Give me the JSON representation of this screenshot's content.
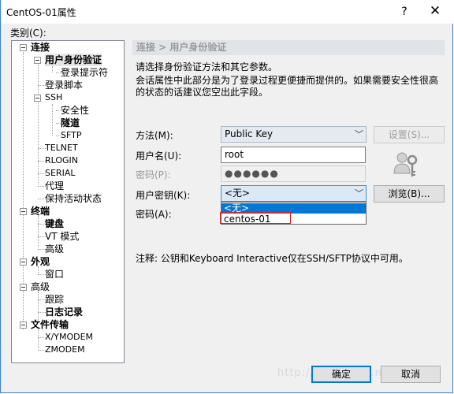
{
  "window": {
    "title": "CentOS-01属性",
    "help": "?",
    "close": "✕"
  },
  "category_label": "类别(C):",
  "tree": [
    {
      "id": "lianjie",
      "label": "连接",
      "bold": true
    },
    {
      "id": "yonghu",
      "label": "用户身份验证",
      "bold": true,
      "selected": true
    },
    {
      "id": "denglu-tishi",
      "label": "登录提示符"
    },
    {
      "id": "denglu-jiaoben",
      "label": "登录脚本"
    },
    {
      "id": "ssh",
      "label": "SSH",
      "small": true
    },
    {
      "id": "anquan",
      "label": "安全性"
    },
    {
      "id": "suidao",
      "label": "隧道",
      "bold": true
    },
    {
      "id": "sftp",
      "label": "SFTP",
      "small": true
    },
    {
      "id": "telnet",
      "label": "TELNET",
      "small": true
    },
    {
      "id": "rlogin",
      "label": "RLOGIN",
      "small": true
    },
    {
      "id": "serial",
      "label": "SERIAL",
      "small": true
    },
    {
      "id": "daili",
      "label": "代理"
    },
    {
      "id": "baochi",
      "label": "保持活动状态"
    },
    {
      "id": "zhongduan",
      "label": "终端",
      "bold": true
    },
    {
      "id": "jianpan",
      "label": "键盘",
      "bold": true
    },
    {
      "id": "vt",
      "label": "VT 模式"
    },
    {
      "id": "gaoji1",
      "label": "高级"
    },
    {
      "id": "waiguan",
      "label": "外观",
      "bold": true
    },
    {
      "id": "chuangkou",
      "label": "窗口"
    },
    {
      "id": "gaoji2",
      "label": "高级"
    },
    {
      "id": "genzong",
      "label": "跟踪"
    },
    {
      "id": "rizhi",
      "label": "日志记录",
      "bold": true
    },
    {
      "id": "wenjian",
      "label": "文件传输",
      "bold": true
    },
    {
      "id": "xymodem",
      "label": "X/YMODEM",
      "small": true
    },
    {
      "id": "zmodem",
      "label": "ZMODEM",
      "small": true
    }
  ],
  "panel": {
    "breadcrumb": "连接 > 用户身份验证",
    "desc1": "请选择身份验证方法和其它参数。",
    "desc2": "会话属性中此部分是为了登录过程更便捷而提供的。如果需要安全性很高的状态的话建议您空出此字段。",
    "method_label": "方法(M):",
    "method_value": "Public Key",
    "settings_button": "设置(S)...",
    "username_label": "用户名(U):",
    "username_value": "root",
    "password_label": "密码(P):",
    "password_value": "●●●●●●",
    "userkey_label": "用户密钥(K):",
    "userkey_value": "<无>",
    "browse_button": "浏览(B)...",
    "passphrase_label": "密码(A):",
    "dropdown_options": [
      "<无>",
      "centos-01"
    ],
    "note": "注释: 公钥和Keyboard Interactive仅在SSH/SFTP协议中可用。"
  },
  "footer": {
    "ok": "确定",
    "cancel": "取消",
    "watermark": "http://blog.csdn.net/..."
  },
  "colors": {
    "accent": "#0078d7",
    "highlight_box": "#e02020",
    "breadcrumb_bg": "#e0e3e8"
  },
  "icons": [
    "help-icon",
    "close-icon",
    "user-key-icon",
    "chevron-down-icon",
    "tree-collapse-icon"
  ]
}
